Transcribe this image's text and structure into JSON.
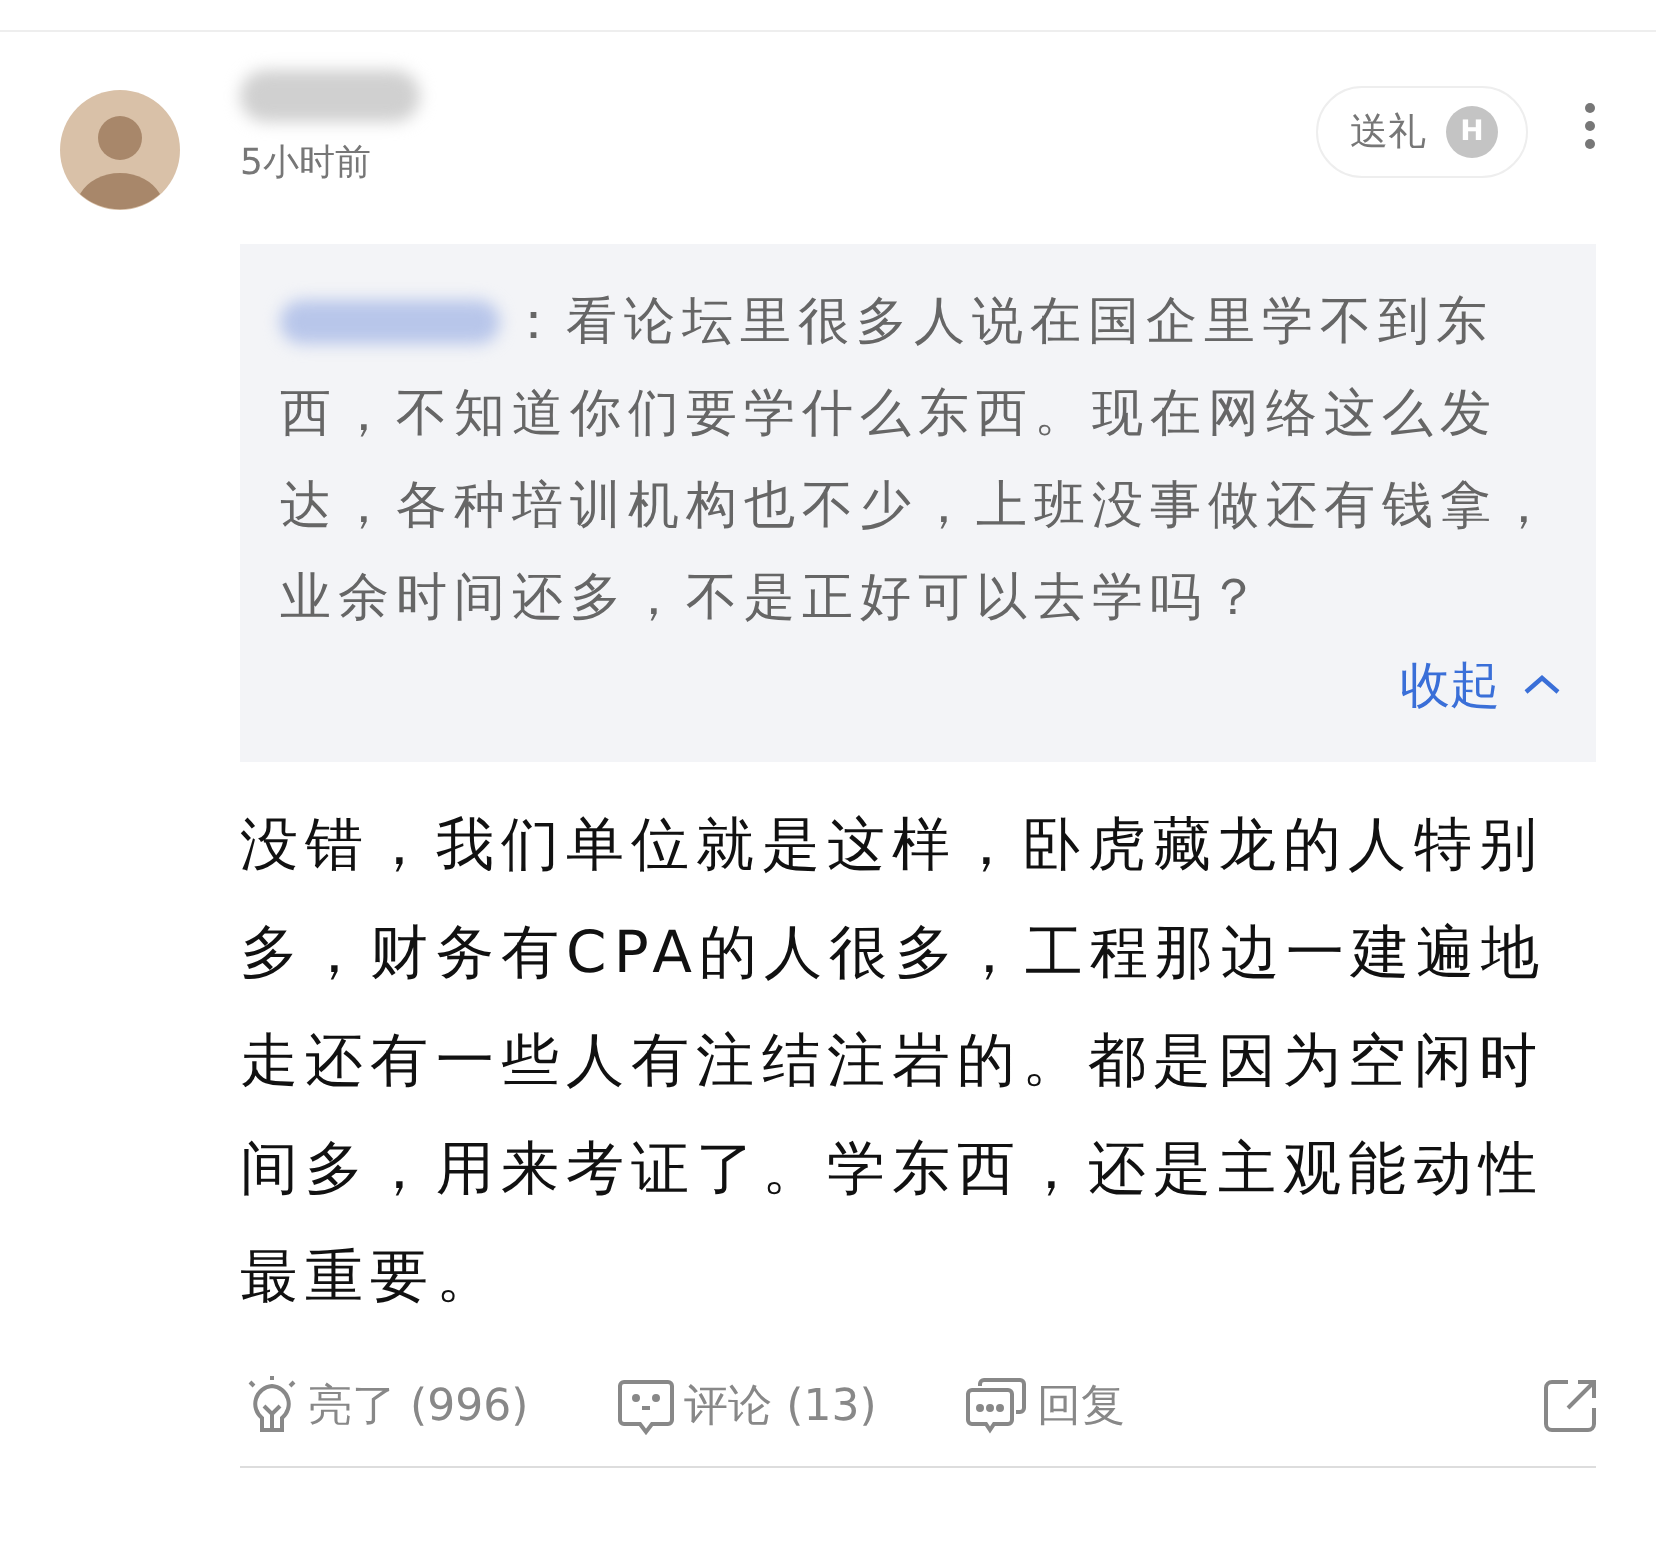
{
  "post": {
    "time": "5小时前",
    "gift_button": {
      "label": "送礼",
      "badge": "H"
    },
    "quote": {
      "text": [
        "：看论坛里很多人说在国企里学不到东",
        "西，不知道你们要学什么东西。现在网络这么发达，各种培训机构也不少，上班没事做还有钱拿，业余时间还多，不是正好可以去学吗？"
      ],
      "collapse": "收起",
      "expanded": true
    },
    "body": "没错，我们单位就是这样，卧虎藏龙的人特别多，财务有CPA的人很多，工程那边一建遍地走还有一些人有注结注岩的。都是因为空闲时间多，用来考证了。学东西，还是主观能动性最重要。",
    "actions": [
      {
        "kind": "like",
        "label": "亮了 (996)"
      },
      {
        "kind": "comment",
        "label": "评论 (13)"
      },
      {
        "kind": "reply",
        "label": "回复"
      },
      {
        "kind": "share"
      }
    ]
  }
}
